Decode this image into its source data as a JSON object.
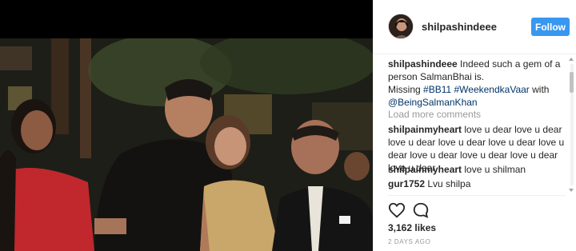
{
  "colors": {
    "accent": "#3897f0",
    "hashtag": "#003569",
    "muted": "#999999"
  },
  "photo": {
    "description_icon": "group-photo"
  },
  "header": {
    "username": "shilpashindeee",
    "follow_label": "Follow"
  },
  "caption": {
    "username": "shilpashindeee",
    "text": " Indeed such a gem of a person SalmanBhai is.",
    "line2_prefix": "Missing ",
    "tag1": "#BB11",
    "tag2": "#WeekendkaVaar",
    "line2_suffix": " with",
    "mention": "@BeingSalmanKhan"
  },
  "load_more": "Load more comments",
  "comments": [
    {
      "username": "shilpainmyheart",
      "text": " love u dear love u dear love u dear love u dear love u dear love u dear love u dear love u dear love u dear love u dear"
    },
    {
      "username": "shilpainmyheart",
      "text": " love u shilman"
    },
    {
      "username": "gur1752",
      "text": " Lvu shilpa"
    }
  ],
  "actions": {
    "like_icon": "heart-icon",
    "comment_icon": "comment-icon"
  },
  "likes": "3,162 likes",
  "timestamp": "2 DAYS AGO"
}
